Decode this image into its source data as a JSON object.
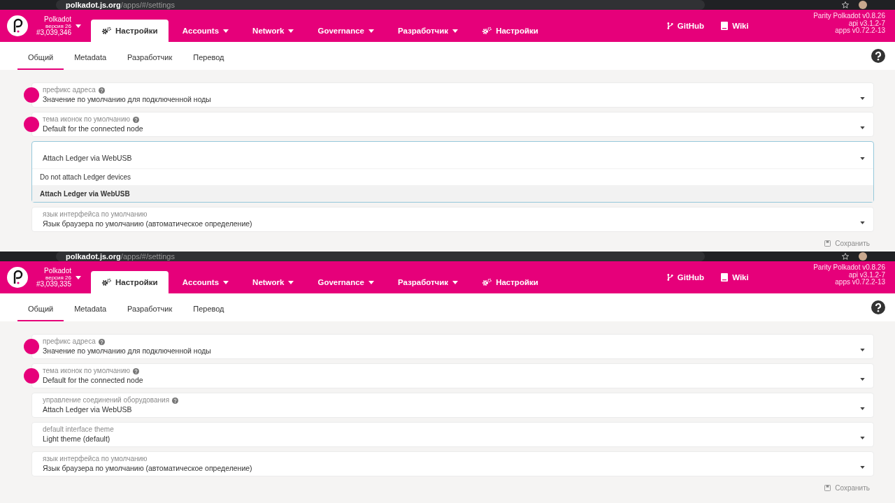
{
  "screens": [
    {
      "browser": {
        "host": "polkadot.js.org",
        "path": "/apps/#/settings"
      },
      "header": {
        "chain": "Polkadot",
        "version": "версия 26",
        "block": "#3,039,346",
        "nav": [
          {
            "label": "Настройки",
            "kind": "page",
            "selected": true
          },
          {
            "label": "Accounts",
            "kind": "menu",
            "selected": false
          },
          {
            "label": "Network",
            "kind": "menu",
            "selected": false
          },
          {
            "label": "Governance",
            "kind": "menu",
            "selected": false
          },
          {
            "label": "Разработчик",
            "kind": "menu",
            "selected": false
          },
          {
            "label": "Настройки",
            "kind": "page",
            "selected": false
          }
        ],
        "links": [
          "GitHub",
          "Wiki"
        ],
        "versions": [
          "Parity Polkadot v0.8.26",
          "api v3.1.2-7",
          "apps v0.72.2-13"
        ]
      },
      "tabs": [
        {
          "label": "Общий",
          "selected": true
        },
        {
          "label": "Metadata",
          "selected": false
        },
        {
          "label": "Разработчик",
          "selected": false
        },
        {
          "label": "Перевод",
          "selected": false
        }
      ],
      "fields": [
        {
          "label": "префикс адреса",
          "help": true,
          "avatar": true,
          "value": "Значение по умолчанию для подключенной ноды"
        },
        {
          "label": "тема иконок по умолчанию",
          "help": true,
          "avatar": true,
          "value": "Default for the connected node"
        },
        {
          "value": "Attach Ledger via WebUSB",
          "open": true,
          "options": [
            {
              "label": "Do not attach Ledger devices",
              "selected": false
            },
            {
              "label": "Attach Ledger via WebUSB",
              "selected": true
            }
          ]
        },
        {
          "label": "язык интерфейса по умолчанию",
          "help": false,
          "avatar": false,
          "value": "Язык браузера по умолчанию (автоматическое определение)"
        }
      ],
      "save": {
        "label": "Сохранить",
        "disabled": true
      }
    },
    {
      "browser": {
        "host": "polkadot.js.org",
        "path": "/apps/#/settings"
      },
      "header": {
        "chain": "Polkadot",
        "version": "версия 26",
        "block": "#3,039,335",
        "nav": [
          {
            "label": "Настройки",
            "kind": "page",
            "selected": true
          },
          {
            "label": "Accounts",
            "kind": "menu",
            "selected": false
          },
          {
            "label": "Network",
            "kind": "menu",
            "selected": false
          },
          {
            "label": "Governance",
            "kind": "menu",
            "selected": false
          },
          {
            "label": "Разработчик",
            "kind": "menu",
            "selected": false
          },
          {
            "label": "Настройки",
            "kind": "page",
            "selected": false
          }
        ],
        "links": [
          "GitHub",
          "Wiki"
        ],
        "versions": [
          "Parity Polkadot v0.8.26",
          "api v3.1.2-7",
          "apps v0.72.2-13"
        ]
      },
      "tabs": [
        {
          "label": "Общий",
          "selected": true
        },
        {
          "label": "Metadata",
          "selected": false
        },
        {
          "label": "Разработчик",
          "selected": false
        },
        {
          "label": "Перевод",
          "selected": false
        }
      ],
      "fields": [
        {
          "label": "префикс адреса",
          "help": true,
          "avatar": true,
          "value": "Значение по умолчанию для подключенной ноды"
        },
        {
          "label": "тема иконок по умолчанию",
          "help": true,
          "avatar": true,
          "value": "Default for the connected node"
        },
        {
          "label": "управление соединений оборудования",
          "help": true,
          "avatar": false,
          "value": "Attach Ledger via WebUSB"
        },
        {
          "label": "default interface theme",
          "help": false,
          "avatar": false,
          "value": "Light theme (default)"
        },
        {
          "label": "язык интерфейса по умолчанию",
          "help": false,
          "avatar": false,
          "value": "Язык браузера по умолчанию (автоматическое определение)"
        }
      ],
      "save": {
        "label": "Сохранить",
        "disabled": true
      }
    }
  ]
}
